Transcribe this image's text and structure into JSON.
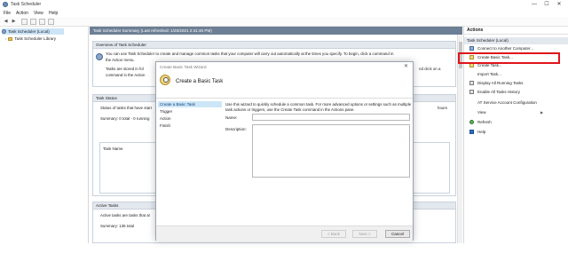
{
  "window": {
    "title": "Task Scheduler",
    "controls": {
      "minimize": "—",
      "maximize": "☐",
      "close": "✕"
    }
  },
  "menubar": {
    "items": [
      "File",
      "Action",
      "View",
      "Help"
    ]
  },
  "toolbar": {
    "back": "◀",
    "forward": "▶"
  },
  "tree": {
    "items": [
      {
        "label": "Task Scheduler (Local)"
      },
      {
        "label": "Task Scheduler Library"
      }
    ]
  },
  "center": {
    "header": "Task Scheduler Summary (Last refreshed: 1/25/2021 2:41:46 PM)",
    "overview": {
      "title": "Overview of Task Scheduler",
      "line1": "You can use Task Scheduler to create and manage common tasks that your computer will carry out automatically at the times you specify. To begin, click a command in",
      "line2": "the Action menu.",
      "line3": "Tasks are stored in fol",
      "line3_right": "nd click on a",
      "line4": "command in the Action"
    },
    "task_status": {
      "title": "Task Status",
      "line1": "Status of tasks that have start",
      "line1_right": "hours",
      "line2": "Summary: 0 total - 0 running",
      "table_header": "Task Name"
    },
    "active_tasks": {
      "title": "Active Tasks",
      "line1": "Active tasks are tasks that ar",
      "line2": "Summary: 135 total"
    }
  },
  "actions": {
    "title": "Actions",
    "section": "Task Scheduler (Local)",
    "items": [
      {
        "label": "Connect to Another Computer...",
        "icon": "computer-icon"
      },
      {
        "label": "Create Basic Task...",
        "icon": "create-basic-task-icon"
      },
      {
        "label": "Create Task...",
        "icon": "create-task-icon"
      },
      {
        "label": "Import Task...",
        "icon": "import-icon"
      },
      {
        "label": "Display All Running Tasks",
        "icon": "running-tasks-icon"
      },
      {
        "label": "Enable All Tasks History",
        "icon": "history-icon"
      },
      {
        "label": "AT Service Account Configuration",
        "icon": "config-icon"
      },
      {
        "label": "View",
        "icon": "view-icon"
      },
      {
        "label": "Refresh",
        "icon": "refresh-icon"
      },
      {
        "label": "Help",
        "icon": "help-icon"
      }
    ],
    "view_arrow": "▶"
  },
  "dialog": {
    "title": "Create Basic Task Wizard",
    "close": "✕",
    "heading": "Create a Basic Task",
    "steps": [
      "Create a Basic Task",
      "Trigger",
      "Action",
      "Finish"
    ],
    "description": "Use this wizard to quickly schedule a common task.  For more advanced options or settings such as multiple task actions or triggers, use the Create Task command in the Actions pane.",
    "name_label": "Name:",
    "name_value": "",
    "description_label": "Description:",
    "description_value": "",
    "buttons": {
      "back": "< Back",
      "next": "Next >",
      "cancel": "Cancel"
    }
  },
  "colors": {
    "header_bar": "#6d7f95",
    "highlight_box": "#e0151b",
    "selected_step": "#cde6f7"
  }
}
